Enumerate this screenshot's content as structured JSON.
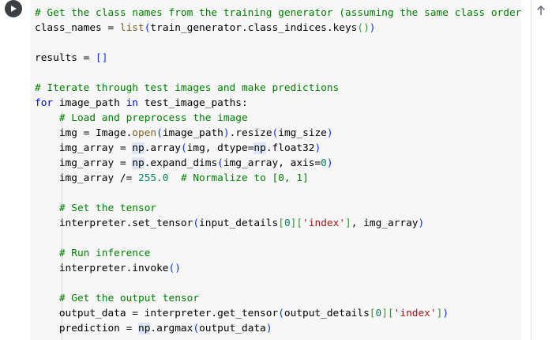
{
  "cell": {
    "run_button_icon": "play-icon",
    "scroll_up_icon": "arrow-up-icon",
    "lines": [
      [
        {
          "t": "# Get the class names from the training generator (assuming the same class order)",
          "c": "comment"
        }
      ],
      [
        {
          "t": "class_names = ",
          "c": ""
        },
        {
          "t": "list",
          "c": "builtin"
        },
        {
          "t": "(",
          "c": "paren"
        },
        {
          "t": "train_generator.class_indices.keys",
          "c": ""
        },
        {
          "t": "()",
          "c": "bracket"
        },
        {
          "t": ")",
          "c": "paren"
        }
      ],
      [
        {
          "t": "",
          "c": ""
        }
      ],
      [
        {
          "t": "results = ",
          "c": ""
        },
        {
          "t": "[]",
          "c": "paren"
        }
      ],
      [
        {
          "t": "",
          "c": ""
        }
      ],
      [
        {
          "t": "# Iterate through test images and make predictions",
          "c": "comment"
        }
      ],
      [
        {
          "t": "for",
          "c": "kw"
        },
        {
          "t": " image_path ",
          "c": ""
        },
        {
          "t": "in",
          "c": "kw"
        },
        {
          "t": " test_image_paths:",
          "c": ""
        }
      ],
      [
        {
          "t": "    ",
          "c": ""
        },
        {
          "t": "# Load and preprocess the image",
          "c": "comment"
        }
      ],
      [
        {
          "t": "    img = Image.",
          "c": ""
        },
        {
          "t": "open",
          "c": "builtin"
        },
        {
          "t": "(",
          "c": "paren"
        },
        {
          "t": "image_path",
          "c": ""
        },
        {
          "t": ")",
          "c": "paren"
        },
        {
          "t": ".resize",
          "c": ""
        },
        {
          "t": "(",
          "c": "paren"
        },
        {
          "t": "img_size",
          "c": ""
        },
        {
          "t": ")",
          "c": "paren"
        }
      ],
      [
        {
          "t": "    img_array = ",
          "c": ""
        },
        {
          "t": "np",
          "c": "highlight"
        },
        {
          "t": ".array",
          "c": ""
        },
        {
          "t": "(",
          "c": "paren"
        },
        {
          "t": "img, dtype=",
          "c": ""
        },
        {
          "t": "np",
          "c": "highlight"
        },
        {
          "t": ".float32",
          "c": ""
        },
        {
          "t": ")",
          "c": "paren"
        }
      ],
      [
        {
          "t": "    img_array = ",
          "c": ""
        },
        {
          "t": "np",
          "c": "highlight"
        },
        {
          "t": ".expand_dims",
          "c": ""
        },
        {
          "t": "(",
          "c": "paren"
        },
        {
          "t": "img_array, axis=",
          "c": ""
        },
        {
          "t": "0",
          "c": "num"
        },
        {
          "t": ")",
          "c": "paren"
        }
      ],
      [
        {
          "t": "    img_array /= ",
          "c": ""
        },
        {
          "t": "255.0",
          "c": "num"
        },
        {
          "t": "  ",
          "c": ""
        },
        {
          "t": "# Normalize to [0, 1]",
          "c": "comment"
        }
      ],
      [
        {
          "t": "",
          "c": ""
        }
      ],
      [
        {
          "t": "    ",
          "c": ""
        },
        {
          "t": "# Set the tensor",
          "c": "comment"
        }
      ],
      [
        {
          "t": "    interpreter.set_tensor",
          "c": ""
        },
        {
          "t": "(",
          "c": "paren"
        },
        {
          "t": "input_details",
          "c": ""
        },
        {
          "t": "[",
          "c": "bracket"
        },
        {
          "t": "0",
          "c": "num"
        },
        {
          "t": "]",
          "c": "bracket"
        },
        {
          "t": "[",
          "c": "bracket"
        },
        {
          "t": "'index'",
          "c": "str"
        },
        {
          "t": "]",
          "c": "bracket"
        },
        {
          "t": ", img_array",
          "c": ""
        },
        {
          "t": ")",
          "c": "paren"
        }
      ],
      [
        {
          "t": "",
          "c": ""
        }
      ],
      [
        {
          "t": "    ",
          "c": ""
        },
        {
          "t": "# Run inference",
          "c": "comment"
        }
      ],
      [
        {
          "t": "    interpreter.invoke",
          "c": ""
        },
        {
          "t": "()",
          "c": "paren"
        }
      ],
      [
        {
          "t": "",
          "c": ""
        }
      ],
      [
        {
          "t": "    ",
          "c": ""
        },
        {
          "t": "# Get the output tensor",
          "c": "comment"
        }
      ],
      [
        {
          "t": "    output_data = interpreter.get_tensor",
          "c": ""
        },
        {
          "t": "(",
          "c": "paren"
        },
        {
          "t": "output_details",
          "c": ""
        },
        {
          "t": "[",
          "c": "bracket"
        },
        {
          "t": "0",
          "c": "num"
        },
        {
          "t": "]",
          "c": "bracket"
        },
        {
          "t": "[",
          "c": "bracket"
        },
        {
          "t": "'index'",
          "c": "str"
        },
        {
          "t": "]",
          "c": "bracket"
        },
        {
          "t": ")",
          "c": "paren"
        }
      ],
      [
        {
          "t": "    prediction = ",
          "c": ""
        },
        {
          "t": "np",
          "c": "highlight"
        },
        {
          "t": ".argmax",
          "c": ""
        },
        {
          "t": "(",
          "c": "paren"
        },
        {
          "t": "output_data",
          "c": ""
        },
        {
          "t": ")",
          "c": "paren"
        }
      ]
    ]
  }
}
